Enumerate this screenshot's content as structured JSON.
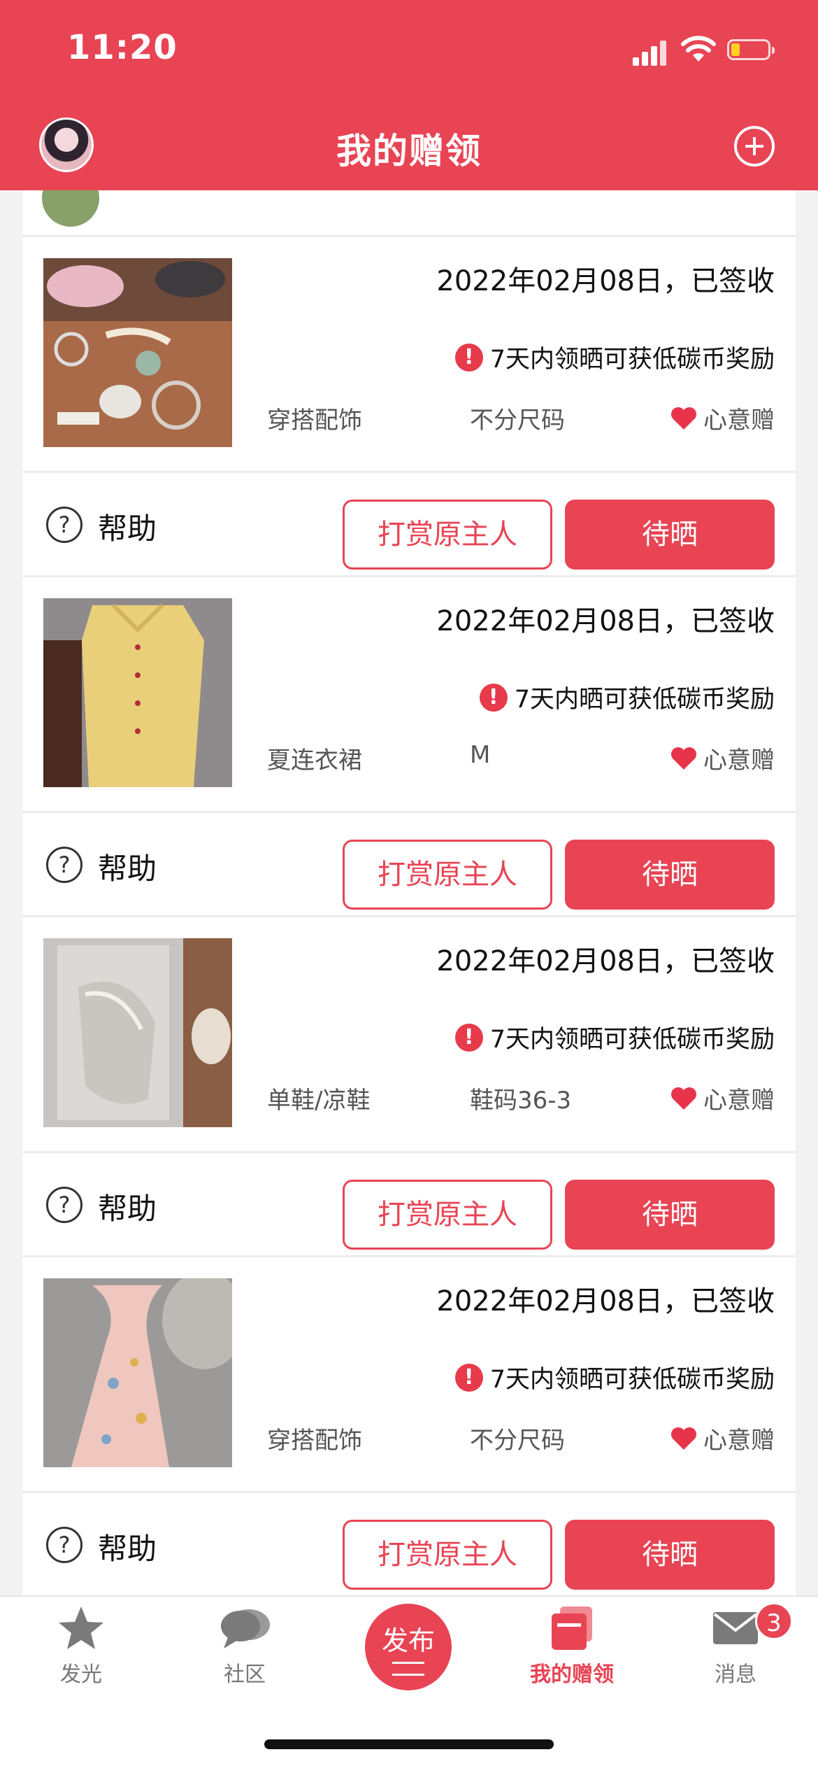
{
  "status_bar": {
    "time": "11:20"
  },
  "header": {
    "title": "我的赠领"
  },
  "items": [
    {
      "date_status": "2022年02月08日，已签收",
      "notice": "7天内领晒可获低碳币奖励",
      "category": "穿搭配饰",
      "size": "不分尺码",
      "gift_type": "心意赠",
      "help_label": "帮助",
      "tip_button": "打赏原主人",
      "action_button": "待晒"
    },
    {
      "date_status": "2022年02月08日，已签收",
      "notice": "7天内晒可获低碳币奖励",
      "category": "夏连衣裙",
      "size": "M",
      "gift_type": "心意赠",
      "help_label": "帮助",
      "tip_button": "打赏原主人",
      "action_button": "待晒"
    },
    {
      "date_status": "2022年02月08日，已签收",
      "notice": "7天内领晒可获低碳币奖励",
      "category": "单鞋/凉鞋",
      "size": "鞋码36-3",
      "gift_type": "心意赠",
      "help_label": "帮助",
      "tip_button": "打赏原主人",
      "action_button": "待晒"
    },
    {
      "date_status": "2022年02月08日，已签收",
      "notice": "7天内领晒可获低碳币奖励",
      "category": "穿搭配饰",
      "size": "不分尺码",
      "gift_type": "心意赠",
      "help_label": "帮助",
      "tip_button": "打赏原主人",
      "action_button": "待晒"
    }
  ],
  "tab_bar": {
    "tabs": [
      {
        "label": "发光",
        "icon": "star-icon"
      },
      {
        "label": "社区",
        "icon": "chat-icon"
      },
      {
        "label": "发布",
        "icon": "publish-icon"
      },
      {
        "label": "我的赠领",
        "icon": "cards-icon",
        "active": true
      },
      {
        "label": "消息",
        "icon": "mail-icon"
      }
    ],
    "message_badge": "3"
  },
  "colors": {
    "brand": "#e84454",
    "warning": "#e73a4a"
  }
}
